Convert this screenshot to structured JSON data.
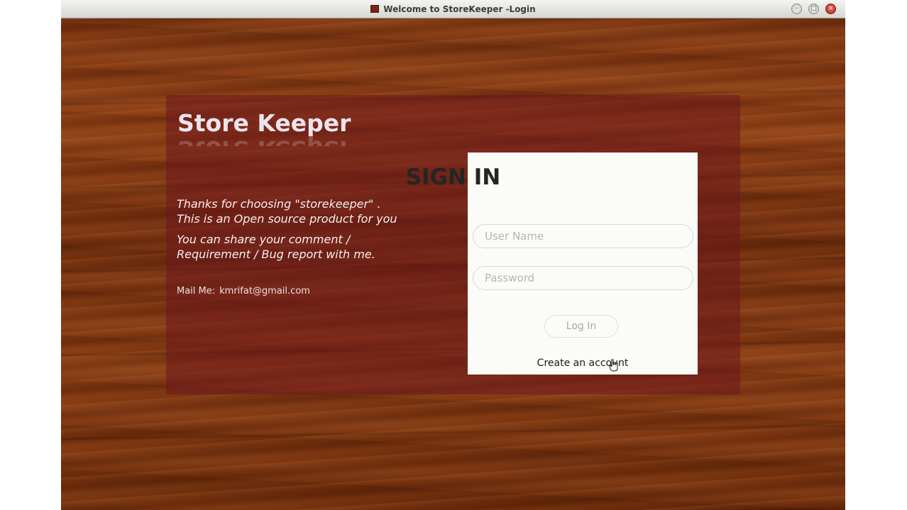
{
  "window": {
    "title": "Welcome to StoreKeeper -Login",
    "app_icon": "storekeeper-app-icon",
    "controls": {
      "minimize_icon": "minimize-icon",
      "maximize_icon": "maximize-icon",
      "close_icon": "close-icon"
    }
  },
  "brand": {
    "title": "Store Keeper",
    "intro_line1": "Thanks for choosing \"storekeeper\" .",
    "intro_line2": "This is an Open source product for you",
    "share_line1": "You can share your comment /",
    "share_line2": "Requirement / Bug report with me.",
    "mail_label": "Mail Me:",
    "mail_address": "kmrifat@gmail.com"
  },
  "signin": {
    "title": "SIGN IN",
    "username_placeholder": "User Name",
    "username_value": "",
    "password_placeholder": "Password",
    "password_value": "",
    "login_label": "Log In",
    "create_account_label": "Create an account"
  },
  "colors": {
    "wood_base": "#6b2a0c",
    "overlay": "#6e161e",
    "panel_background": "#fbfcf8",
    "title_text": "#252525"
  }
}
